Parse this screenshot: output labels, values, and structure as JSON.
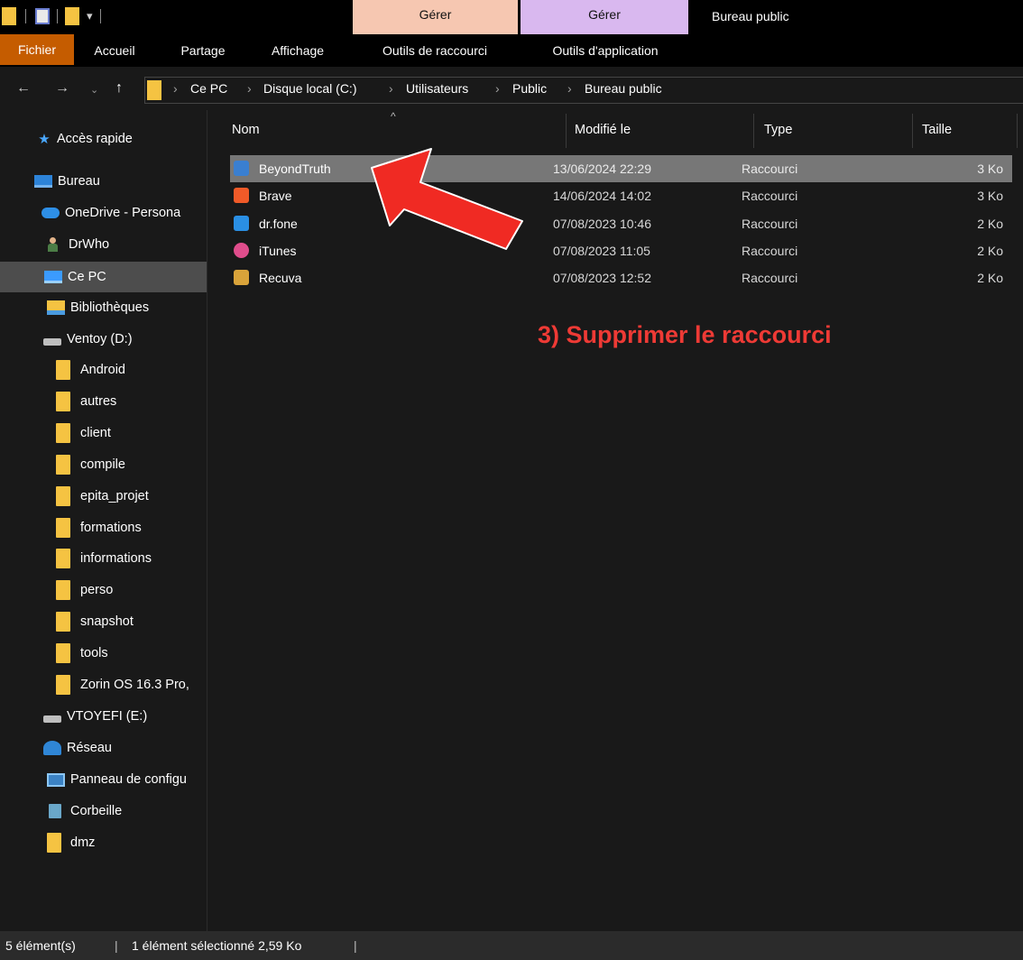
{
  "titlebar": {
    "contextual_tab_1": "Gérer",
    "contextual_tab_2": "Gérer",
    "window_title": "Bureau public"
  },
  "ribbon": {
    "tabs": [
      "Fichier",
      "Accueil",
      "Partage",
      "Affichage",
      "Outils de raccourci",
      "Outils d'application"
    ]
  },
  "address": {
    "breadcrumbs": [
      "Ce PC",
      "Disque local (C:)",
      "Utilisateurs",
      "Public",
      "Bureau public"
    ]
  },
  "sidebar": {
    "items": [
      {
        "label": "Accès rapide",
        "icon": "star-icon"
      },
      {
        "label": "Bureau",
        "icon": "desktop-icon"
      },
      {
        "label": "OneDrive - Persona",
        "icon": "cloud-icon"
      },
      {
        "label": "DrWho",
        "icon": "user-icon"
      },
      {
        "label": "Ce PC",
        "icon": "computer-icon",
        "selected": true
      },
      {
        "label": "Bibliothèques",
        "icon": "library-icon"
      },
      {
        "label": "Ventoy (D:)",
        "icon": "drive-icon"
      },
      {
        "label": "Android",
        "icon": "folder-icon"
      },
      {
        "label": "autres",
        "icon": "folder-icon"
      },
      {
        "label": "client",
        "icon": "folder-icon"
      },
      {
        "label": "compile",
        "icon": "folder-icon"
      },
      {
        "label": "epita_projet",
        "icon": "folder-icon"
      },
      {
        "label": "formations",
        "icon": "folder-icon"
      },
      {
        "label": "informations",
        "icon": "folder-icon"
      },
      {
        "label": "perso",
        "icon": "folder-icon"
      },
      {
        "label": "snapshot",
        "icon": "folder-icon"
      },
      {
        "label": "tools",
        "icon": "folder-icon"
      },
      {
        "label": "Zorin OS 16.3 Pro,",
        "icon": "folder-icon"
      },
      {
        "label": "VTOYEFI (E:)",
        "icon": "drive-icon"
      },
      {
        "label": "Réseau",
        "icon": "network-icon"
      },
      {
        "label": "Panneau de configu",
        "icon": "control-panel-icon"
      },
      {
        "label": "Corbeille",
        "icon": "recycle-bin-icon"
      },
      {
        "label": "dmz",
        "icon": "folder-icon"
      }
    ]
  },
  "columns": {
    "name": "Nom",
    "modified": "Modifié le",
    "type": "Type",
    "size": "Taille"
  },
  "files": [
    {
      "name": "BeyondTruth",
      "modified": "13/06/2024 22:29",
      "type": "Raccourci",
      "size": "3 Ko",
      "selected": true,
      "icon_color": "#3a7fd0"
    },
    {
      "name": "Brave",
      "modified": "14/06/2024 14:02",
      "type": "Raccourci",
      "size": "3 Ko",
      "icon_color": "#f05a28"
    },
    {
      "name": "dr.fone",
      "modified": "07/08/2023 10:46",
      "type": "Raccourci",
      "size": "2 Ko",
      "icon_color": "#2a8fe4"
    },
    {
      "name": "iTunes",
      "modified": "07/08/2023 11:05",
      "type": "Raccourci",
      "size": "2 Ko",
      "icon_color": "#e04d8c"
    },
    {
      "name": "Recuva",
      "modified": "07/08/2023 12:52",
      "type": "Raccourci",
      "size": "2 Ko",
      "icon_color": "#d9a33a"
    }
  ],
  "annotation": {
    "text": "3) Supprimer le raccourci",
    "color": "#ee3a35"
  },
  "status": {
    "count": "5 élément(s)",
    "selection": "1 élément sélectionné  2,59 Ko"
  }
}
